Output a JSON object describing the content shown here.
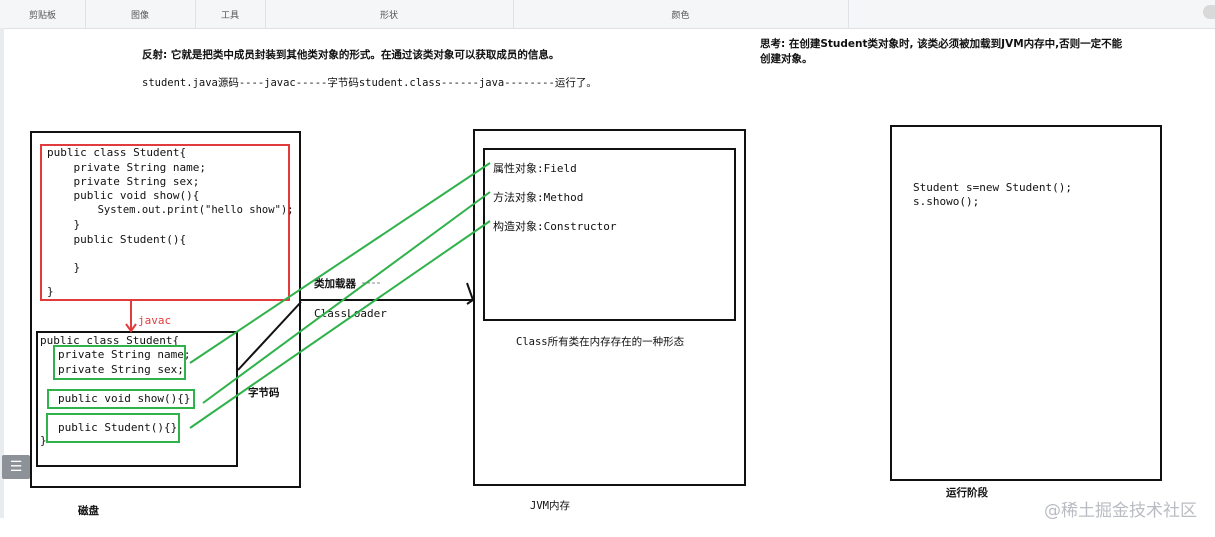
{
  "ribbon": {
    "sections": [
      "剪贴板",
      "图像",
      "工具",
      "形状",
      "颜色"
    ]
  },
  "notes": {
    "reflection": "反射: 它就是把类中成员封装到其他类对象的形式。在通过该类对象可以获取成员的信息。",
    "pipeline": "student.java源码----javac-----字节码student.class------java--------运行了。",
    "think_line1": "思考: 在创建Student类对象时, 该类必须被加载到JVM内存中,否则一定不能",
    "think_line2": "创建对象。"
  },
  "disk": {
    "label": "磁盘",
    "source_code": [
      "public class Student{",
      "    private String name;",
      "    private String sex;",
      "    public void show(){",
      "        System.out.print(\"hello show\");",
      "    }",
      "    public Student(){",
      "",
      "    }",
      "}"
    ],
    "javac_label": "javac",
    "bytecode_header": "public class Student{",
    "bytecode_fields": [
      "private String name;",
      "private String sex;"
    ],
    "bytecode_method": "public void show(){}",
    "bytecode_ctor": "public Student(){}",
    "bytecode_close": "}",
    "bytecode_label": "字节码"
  },
  "loader": {
    "label_cn": "类加载器",
    "label_en": "ClassLoader"
  },
  "jvm": {
    "label": "JVM内存",
    "items": [
      "属性对象:Field",
      "方法对象:Method",
      "构造对象:Constructor"
    ],
    "class_caption": "Class所有类在内存存在的一种形态"
  },
  "runtime": {
    "label": "运行阶段",
    "code": [
      "Student s=new Student();",
      "s.showo();"
    ]
  },
  "watermark": "@稀土掘金技术社区",
  "colors": {
    "red": "#e23b3b",
    "green": "#2fb24a",
    "black": "#111111",
    "ribbon_bg": "#f5f6f7"
  },
  "icons": {
    "menu": "menu-icon"
  }
}
